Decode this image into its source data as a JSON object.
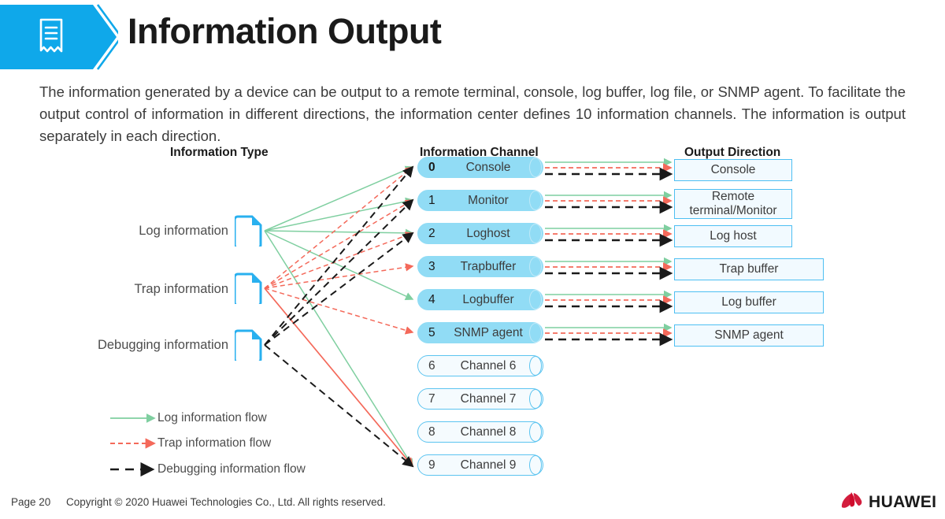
{
  "header": {
    "title": "Information Output",
    "icon": "document-receipt-icon",
    "banner_color": "#0fa8ea"
  },
  "intro": {
    "paragraph": "The information generated by a device can be output to a remote terminal, console, log buffer, log file, or SNMP agent. To facilitate the output control of information in different directions, the information center defines 10 information channels. The information is output separately in each direction."
  },
  "diagram": {
    "columns": {
      "information_type": "Information Type",
      "information_channel": "Information Channel",
      "output_direction": "Output Direction"
    },
    "information_types": [
      {
        "label": "Log information",
        "icon": "document-icon"
      },
      {
        "label": "Trap information",
        "icon": "document-icon"
      },
      {
        "label": "Debugging information",
        "icon": "document-icon"
      }
    ],
    "channels": [
      {
        "num": "0",
        "name": "Console",
        "active": true
      },
      {
        "num": "1",
        "name": "Monitor",
        "active": true
      },
      {
        "num": "2",
        "name": "Loghost",
        "active": true
      },
      {
        "num": "3",
        "name": "Trapbuffer",
        "active": true
      },
      {
        "num": "4",
        "name": "Logbuffer",
        "active": true
      },
      {
        "num": "5",
        "name": "SNMP agent",
        "active": true
      },
      {
        "num": "6",
        "name": "Channel 6",
        "active": false
      },
      {
        "num": "7",
        "name": "Channel 7",
        "active": false
      },
      {
        "num": "8",
        "name": "Channel 8",
        "active": false
      },
      {
        "num": "9",
        "name": "Channel 9",
        "active": false
      }
    ],
    "outputs": [
      {
        "label": "Console"
      },
      {
        "label": "Remote terminal/Monitor",
        "line1": "Remote",
        "line2": "terminal/Monitor"
      },
      {
        "label": "Log host"
      },
      {
        "label": "Trap buffer"
      },
      {
        "label": "Log buffer"
      },
      {
        "label": "SNMP agent"
      }
    ],
    "legend": [
      {
        "label": "Log information flow",
        "style": "solid",
        "color": "#7fcfa0"
      },
      {
        "label": "Trap information flow",
        "style": "dashed",
        "color": "#f4695a"
      },
      {
        "label": "Debugging information flow",
        "style": "dashed",
        "color": "#1a1a1a"
      }
    ]
  },
  "footer": {
    "page": "Page 20",
    "copyright": "Copyright © 2020 Huawei Technologies Co., Ltd. All rights reserved.",
    "brand": "HUAWEI"
  },
  "colors": {
    "brand_blue": "#0fa8ea",
    "channel_fill": "#91dcf5",
    "channel_border": "#5cc4f0",
    "output_fill": "#f2faff",
    "output_border": "#4ebff2",
    "log_flow": "#7fcfa0",
    "trap_flow": "#f4695a",
    "debug_flow": "#1a1a1a",
    "huawei_red": "#cf0a2c"
  }
}
